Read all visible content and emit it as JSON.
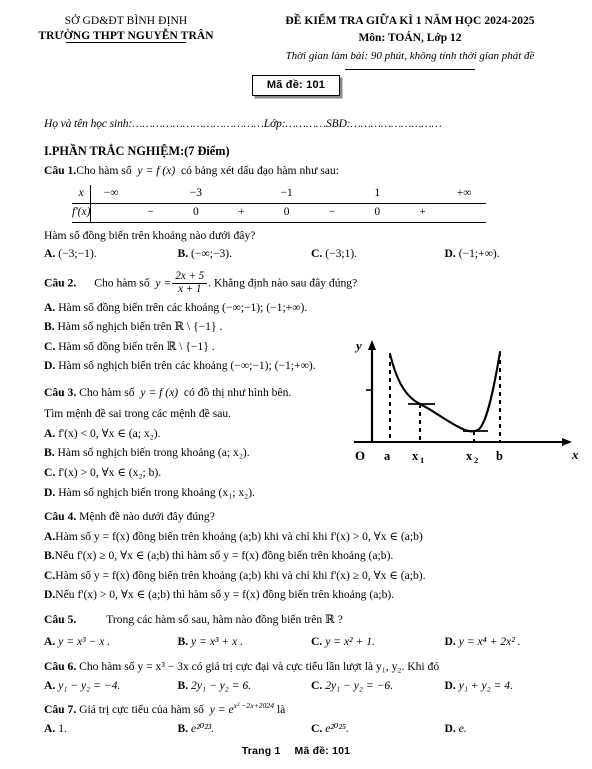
{
  "header": {
    "dept": "SỞ GD&ĐT BÌNH ĐỊNH",
    "school": "TRƯỜNG THPT NGUYỄN TRÂN",
    "exam_title": "ĐỀ KIỂM TRA GIỮA KÌ 1 NĂM HỌC 2024-2025",
    "subject": "Môn:  TOÁN, Lớp 12",
    "duration": "Thời gian làm bài: 90 phút, không tính thời gian phát đề",
    "code_label": "Mã đề:",
    "code_value": "101",
    "student_line": "Họ và tên học sinh:…………………………………Lớp:…………SBD:………………………"
  },
  "section": {
    "title": "I.PHẦN TRẮC NGHIỆM:(7 Điểm)"
  },
  "questions": [
    {
      "num": "Câu 1.",
      "stem_pre": "Cho hàm số",
      "stem_post": "có bảng xét dấu đạo hàm như sau:",
      "sub_question": "Hàm số đồng biến trên khoảng nào dưới đây?",
      "table": {
        "row_x_label": "x",
        "row_d_label": "f'(x)",
        "x_values": [
          "−∞",
          "−3",
          "−1",
          "1",
          "+∞"
        ],
        "signs": [
          "−",
          "0",
          "+",
          "0",
          "−",
          "0",
          "+"
        ]
      },
      "options": [
        {
          "letter": "A.",
          "text": "(−3;−1)."
        },
        {
          "letter": "B.",
          "text": "(−∞;−3)."
        },
        {
          "letter": "C.",
          "text": "(−3;1)."
        },
        {
          "letter": "D.",
          "text": "(−1;+∞)."
        }
      ]
    },
    {
      "num": "Câu 2.",
      "stem_pre": "Cho hàm số",
      "stem_post": ". Khẳng định nào sau đây đúng?",
      "fraction": {
        "numerator": "2x + 5",
        "denominator": "x + 1"
      },
      "options": [
        {
          "letter": "A.",
          "text": "Hàm số đồng biến trên các khoảng (−∞;−1); (−1;+∞)."
        },
        {
          "letter": "B.",
          "text": "Hàm số nghịch biến trên ℝ \\ {−1} ."
        },
        {
          "letter": "C.",
          "text": "Hàm số đồng biến trên ℝ \\ {−1} ."
        },
        {
          "letter": "D.",
          "text": "Hàm số nghịch biến trên các khoảng (−∞;−1); (−1;+∞)."
        }
      ]
    },
    {
      "num": "Câu 3.",
      "stem_pre": "Cho hàm số",
      "stem_post": "có đồ thị như hình bên.",
      "sub_question": "Tìm mệnh đề sai trong các mệnh đề sau.",
      "options": [
        {
          "letter": "A.",
          "text": "f'(x) < 0, ∀x ∈ (a; x₂)."
        },
        {
          "letter": "B.",
          "text": "Hàm số nghịch biến trong khoảng (a; x₂)."
        },
        {
          "letter": "C.",
          "text": "f'(x) > 0, ∀x ∈ (x₂; b)."
        },
        {
          "letter": "D.",
          "text": "Hàm số nghịch biến trong khoảng (x₁; x₂)."
        }
      ]
    },
    {
      "num": "Câu 4.",
      "stem_pre": "Mệnh đề nào dưới đây đúng?",
      "options": [
        {
          "letter": "A.",
          "text": "Hàm số y = f(x) đồng biến trên khoảng (a;b) khi và chỉ khi  f'(x) > 0, ∀x ∈ (a;b)"
        },
        {
          "letter": "B.",
          "text": "Nếu  f'(x) ≥ 0, ∀x ∈ (a;b) thì hàm số  y = f(x) đồng biến trên khoảng (a;b)."
        },
        {
          "letter": "C.",
          "text": "Hàm số y = f(x) đồng biến trên khoảng (a;b) khi và chỉ khi  f'(x) ≥ 0, ∀x ∈ (a;b)."
        },
        {
          "letter": "D.",
          "text": "Nếu  f'(x) > 0, ∀x ∈ (a;b) thì hàm số  y = f(x) đồng biến trên khoảng (a;b)."
        }
      ]
    },
    {
      "num": "Câu 5.",
      "stem_pre": "Trong các hàm số sau, hàm nào đồng biến trên ℝ ?",
      "options": [
        {
          "letter": "A.",
          "text": "y = x³ − x ."
        },
        {
          "letter": "B.",
          "text": "y = x³ + x ."
        },
        {
          "letter": "C.",
          "text": "y = x² + 1."
        },
        {
          "letter": "D.",
          "text": "y = x⁴ + 2x² ."
        }
      ]
    },
    {
      "num": "Câu 6.",
      "stem_pre": "Cho hàm số y = x³ − 3x có giá trị cực đại và cực tiểu lần lượt là  y₁, y₂. Khi đó",
      "options": [
        {
          "letter": "A.",
          "text": "y₁ − y₂ = −4."
        },
        {
          "letter": "B.",
          "text": "2y₁ − y₂ = 6."
        },
        {
          "letter": "C.",
          "text": "2y₁ − y₂ = −6."
        },
        {
          "letter": "D.",
          "text": "y₁ + y₂ = 4."
        }
      ]
    },
    {
      "num": "Câu 7.",
      "stem_pre": "Giá trị cực tiểu của hàm số",
      "stem_post": "là",
      "exponent_base": "e",
      "exponent": "x² −2x+2024",
      "options": [
        {
          "letter": "A.",
          "text": "1."
        },
        {
          "letter": "B.",
          "text": "e²⁰²³."
        },
        {
          "letter": "C.",
          "text": "e²⁰²⁵."
        },
        {
          "letter": "D.",
          "text": "e."
        }
      ]
    }
  ],
  "figure": {
    "y_axis_label": "y",
    "x_axis_label": "x",
    "origin_label": "O",
    "tick_labels": [
      "a",
      "x",
      "x",
      "b"
    ],
    "tick_label_a": "a",
    "tick_label_x1": "x",
    "tick_label_x1_sub": "1",
    "tick_label_x2": "x",
    "tick_label_x2_sub": "2",
    "tick_label_b": "b"
  },
  "footer": {
    "page_label": "Trang 1",
    "code": "Mã đề:  101"
  }
}
